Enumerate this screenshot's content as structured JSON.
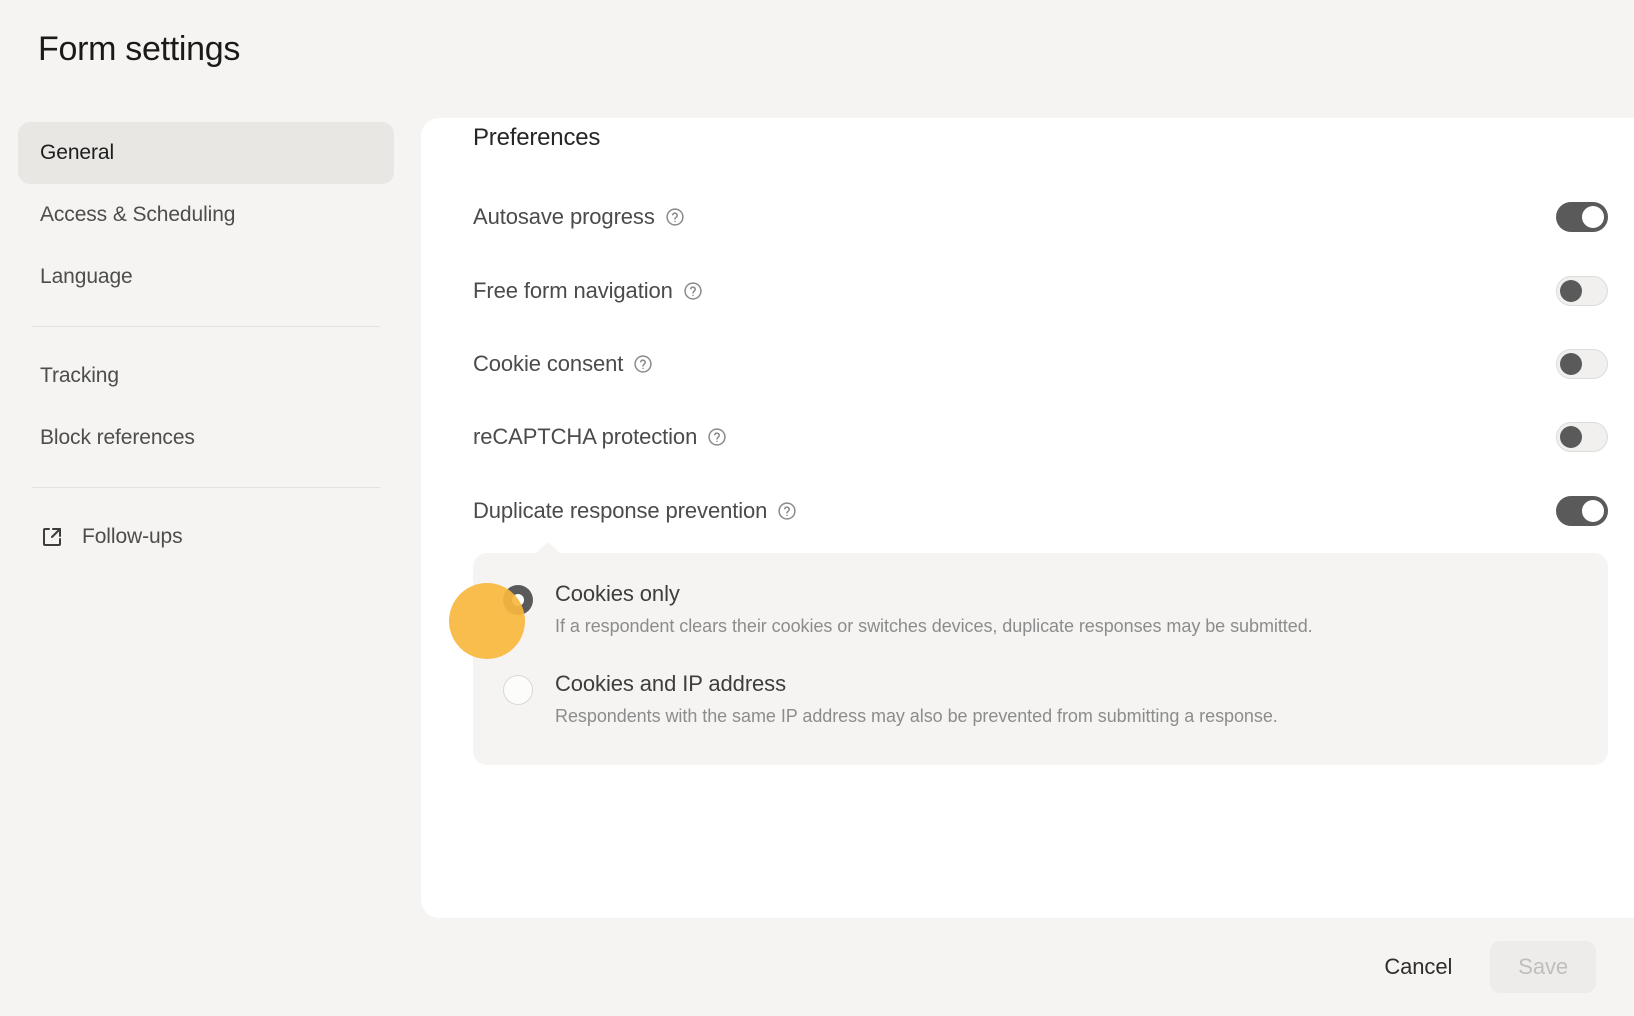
{
  "header": {
    "title": "Form settings"
  },
  "sidebar": {
    "groups": [
      {
        "items": [
          {
            "label": "General",
            "active": true,
            "icon": null
          },
          {
            "label": "Access & Scheduling",
            "active": false,
            "icon": null
          },
          {
            "label": "Language",
            "active": false,
            "icon": null
          }
        ]
      },
      {
        "items": [
          {
            "label": "Tracking",
            "active": false,
            "icon": null
          },
          {
            "label": "Block references",
            "active": false,
            "icon": null
          }
        ]
      },
      {
        "items": [
          {
            "label": "Follow-ups",
            "active": false,
            "icon": "external-link-icon"
          }
        ]
      }
    ]
  },
  "main": {
    "section_title": "Preferences",
    "preferences": [
      {
        "label": "Autosave progress",
        "help_icon": "help-circle-icon",
        "toggle": "on"
      },
      {
        "label": "Free form navigation",
        "help_icon": "help-circle-icon",
        "toggle": "off"
      },
      {
        "label": "Cookie consent",
        "help_icon": "help-circle-icon",
        "toggle": "off"
      },
      {
        "label": "reCAPTCHA protection",
        "help_icon": "help-circle-icon",
        "toggle": "off"
      },
      {
        "label": "Duplicate response prevention",
        "help_icon": "help-circle-icon",
        "toggle": "on"
      }
    ],
    "duplicate_prevention_options": [
      {
        "title": "Cookies only",
        "description": "If a respondent clears their cookies or switches devices, duplicate responses may be submitted.",
        "selected": true
      },
      {
        "title": "Cookies and IP address",
        "description": "Respondents with the same IP address may also be prevented from submitting a response.",
        "selected": false
      }
    ]
  },
  "footer": {
    "cancel_label": "Cancel",
    "save_label": "Save",
    "save_disabled": true
  },
  "colors": {
    "page_background": "#F5F4F2",
    "card_background": "#FFFFFF",
    "toggle_on": "#5A5A5A",
    "toggle_off_track": "#F1F0EE",
    "active_nav": "#E8E7E4",
    "cursor_highlight": "#F7B73D",
    "save_disabled_bg": "#EDECEA"
  }
}
